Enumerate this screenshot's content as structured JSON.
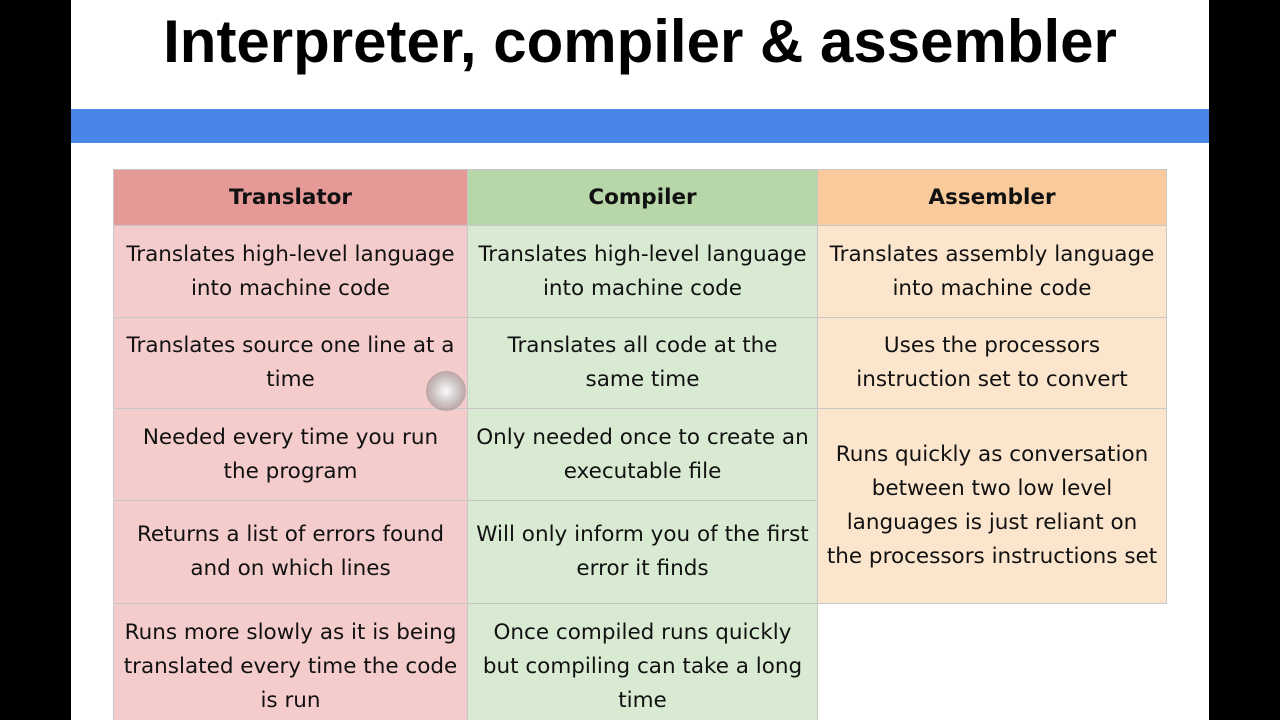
{
  "slide": {
    "title": "Interpreter, compiler & assembler",
    "accent_bar_color": "#4a86e8"
  },
  "table": {
    "headers": {
      "translator": "Translator",
      "compiler": "Compiler",
      "assembler": "Assembler"
    },
    "translator": [
      "Translates high-level language into machine code",
      "Translates source one line at a time",
      "Needed every time you run the program",
      "Returns a list of errors found and on which lines",
      "Runs more slowly as it is being translated every time the code is run"
    ],
    "compiler": [
      "Translates high-level language into machine code",
      "Translates all code at the same time",
      "Only needed once to create an executable file",
      "Will only inform you of the first error it finds",
      "Once compiled runs quickly but compiling can take a long time"
    ],
    "assembler": [
      "Translates assembly language into machine code",
      "Uses the processors instruction set to convert",
      "Runs quickly as conversation between two low level languages is just reliant on the processors instructions set"
    ],
    "colors": {
      "translator_header": "#e59a98",
      "translator_cell": "#f4cccc",
      "compiler_header": "#b7d7a8",
      "compiler_cell": "#d9ead3",
      "assembler_header": "#f9cb9c",
      "assembler_cell": "#fce5cd"
    }
  }
}
